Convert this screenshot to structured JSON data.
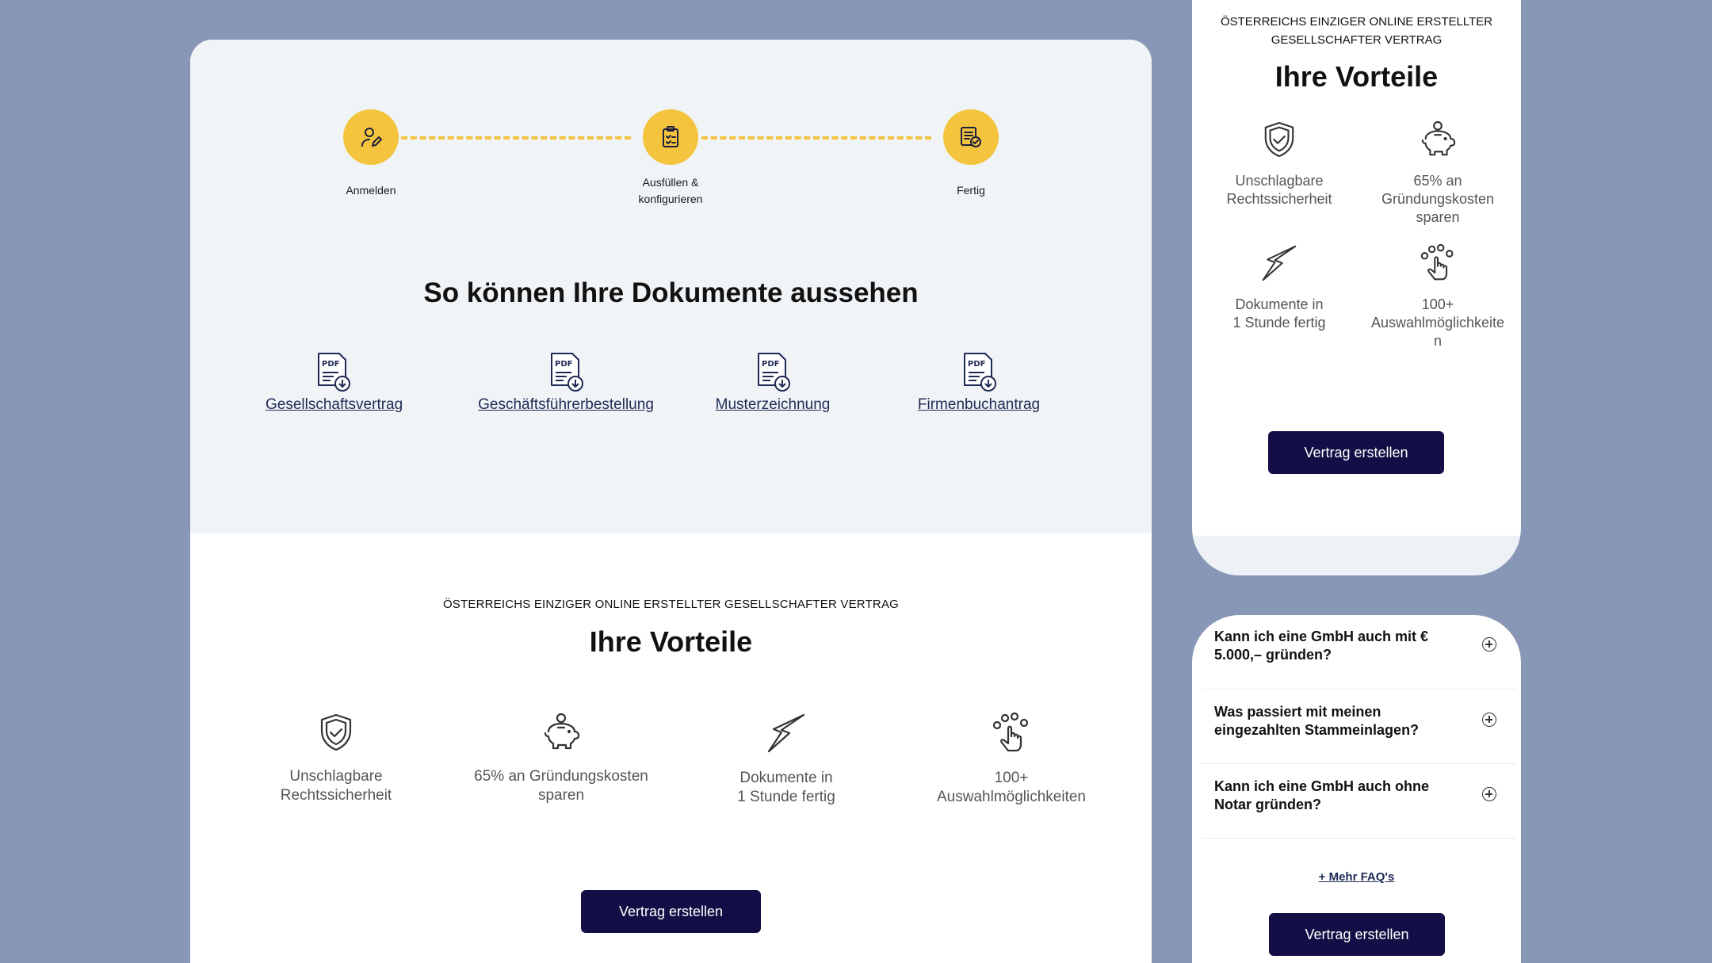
{
  "steps": [
    {
      "label": "Anmelden"
    },
    {
      "label": "Ausfüllen & konfigurieren"
    },
    {
      "label": "Fertig"
    }
  ],
  "documents": {
    "title": "So können Ihre Dokumente aussehen",
    "icon_text": "PDF",
    "items": [
      {
        "label": "Gesellschaftsvertrag"
      },
      {
        "label": "Geschäftsführerbestellung"
      },
      {
        "label": "Musterzeichnung"
      },
      {
        "label": "Firmenbuchantrag"
      }
    ]
  },
  "benefits": {
    "eyebrow": "ÖSTERREICHS EINZIGER ONLINE ERSTELLTER GESELLSCHAFTER VERTRAG",
    "title": "Ihre Vorteile",
    "items": [
      {
        "line1": "Unschlagbare",
        "line2": "Rechtssicherheit",
        "icon": "shield-check-icon"
      },
      {
        "line1": "65% an Gründungskosten",
        "line2": "sparen",
        "icon": "piggy-bank-icon"
      },
      {
        "line1": "Dokumente in",
        "line2": "1 Stunde fertig",
        "icon": "lightning-icon"
      },
      {
        "line1": "100+",
        "line2": "Auswahlmöglichkeiten",
        "icon": "hand-pointer-icon"
      }
    ],
    "cta": "Vertrag erstellen"
  },
  "mobile_benefits": {
    "eyebrow_line1": "ÖSTERREICHS EINZIGER ONLINE ERSTELLTER",
    "eyebrow_line2": "GESELLSCHAFTER VERTRAG",
    "title": "Ihre Vorteile",
    "items": [
      {
        "lines": [
          "Unschlagbare",
          "Rechtssicherheit"
        ]
      },
      {
        "lines": [
          "65% an",
          "Gründungskosten",
          "sparen"
        ]
      },
      {
        "lines": [
          "Dokumente in",
          "1 Stunde fertig"
        ]
      },
      {
        "lines": [
          "100+",
          "Auswahlmöglichkeite",
          "n"
        ]
      }
    ],
    "cta": "Vertrag erstellen"
  },
  "faq": {
    "items": [
      {
        "question": "Kann ich eine GmbH auch mit € 5.000,– gründen?"
      },
      {
        "question": "Was passiert mit meinen eingezahlten Stammeinlagen?"
      },
      {
        "question": "Kann ich eine GmbH auch ohne Notar gründen?"
      }
    ],
    "more": "+ Mehr FAQ's",
    "cta": "Vertrag erstellen"
  },
  "colors": {
    "accent_yellow": "#f4c43e",
    "cta_navy": "#130e45",
    "background": "#8797b5"
  }
}
